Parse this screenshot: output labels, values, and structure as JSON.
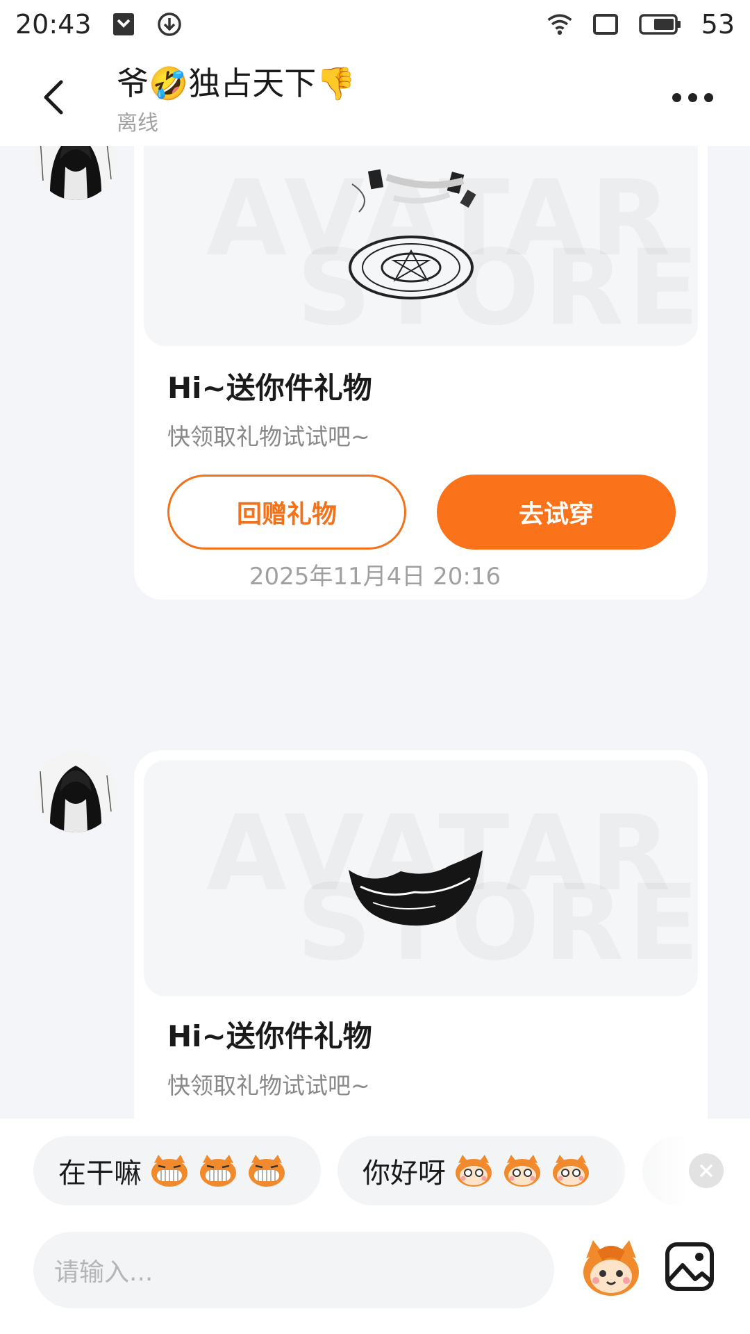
{
  "status_bar": {
    "time": "20:43",
    "battery": "53",
    "icons": [
      "shield-icon",
      "download-icon",
      "wifi-icon",
      "screen-icon",
      "battery-icon"
    ]
  },
  "header": {
    "title": "爷🤣独占天下👎",
    "status": "离线",
    "icons": [
      "back-icon",
      "more-icon"
    ]
  },
  "messages": [
    {
      "type": "gift_card",
      "title": "Hi~送你件礼物",
      "subtitle": "快领取礼物试试吧~",
      "watermark_top": "AVATAR",
      "watermark_bottom": "STORE",
      "gift_icon": "magic-circle-item-icon",
      "secondary_button": "回赠礼物",
      "primary_button": "去试穿"
    },
    {
      "type": "timestamp",
      "text": "2025年11月4日 20:16"
    },
    {
      "type": "gift_card",
      "title": "Hi~送你件礼物",
      "subtitle": "快领取礼物试试吧~",
      "watermark_top": "AVATAR",
      "watermark_bottom": "STORE",
      "gift_icon": "teeth-grin-item-icon"
    }
  ],
  "quick_replies": [
    {
      "text": "在干嘛",
      "emoji": "grinning-mascot-icon"
    },
    {
      "text": "你好呀",
      "emoji": "blushing-mascot-icon"
    }
  ],
  "composer": {
    "placeholder": "请输入...",
    "icons": [
      "mascot-emoji-icon",
      "image-icon"
    ]
  },
  "colors": {
    "accent": "#fa7219",
    "background": "#f3f5f8",
    "card": "#ffffff",
    "muted_text": "#a0a0a0"
  }
}
